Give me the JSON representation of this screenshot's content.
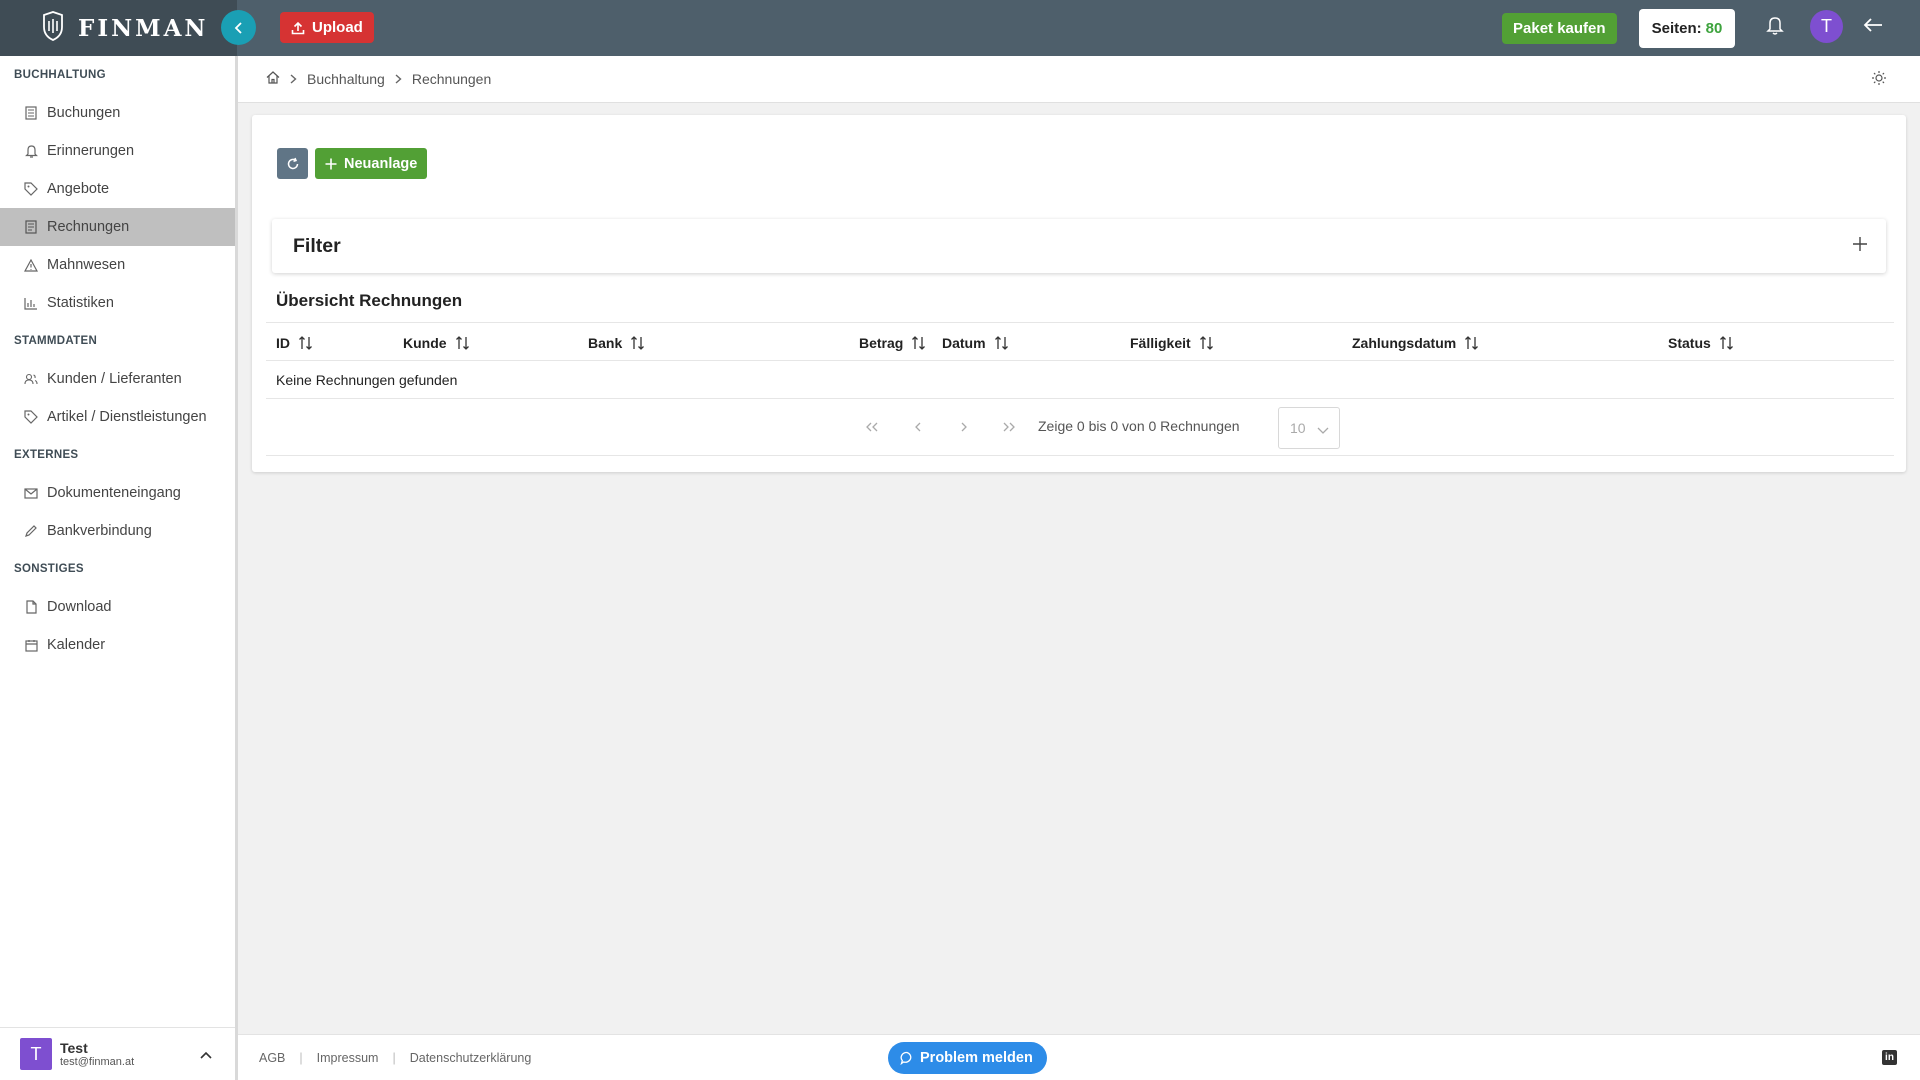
{
  "app": {
    "logo_text": "FINMAN",
    "brand_color": "#4e5f6b"
  },
  "topbar": {
    "upload_label": "Upload",
    "paket_label": "Paket kaufen",
    "seiten_label": "Seiten:",
    "seiten_value": "80",
    "avatar_letter": "T"
  },
  "sidebar": {
    "sections": [
      {
        "title": "BUCHHALTUNG",
        "items": [
          {
            "label": "Buchungen",
            "icon": "ledger-icon"
          },
          {
            "label": "Erinnerungen",
            "icon": "bell-icon"
          },
          {
            "label": "Angebote",
            "icon": "tag-icon"
          },
          {
            "label": "Rechnungen",
            "icon": "invoice-icon",
            "active": true
          },
          {
            "label": "Mahnwesen",
            "icon": "warning-icon"
          },
          {
            "label": "Statistiken",
            "icon": "chart-icon"
          }
        ]
      },
      {
        "title": "STAMMDATEN",
        "items": [
          {
            "label": "Kunden / Lieferanten",
            "icon": "users-icon"
          },
          {
            "label": "Artikel / Dienstleistungen",
            "icon": "tag-icon"
          }
        ]
      },
      {
        "title": "EXTERNES",
        "items": [
          {
            "label": "Dokumenteneingang",
            "icon": "mail-icon"
          },
          {
            "label": "Bankverbindung",
            "icon": "pencil-icon"
          }
        ]
      },
      {
        "title": "SONSTIGES",
        "items": [
          {
            "label": "Download",
            "icon": "file-icon"
          },
          {
            "label": "Kalender",
            "icon": "calendar-icon"
          }
        ]
      }
    ],
    "user": {
      "avatar_letter": "T",
      "name": "Test",
      "email": "test@finman.at"
    }
  },
  "breadcrumb": {
    "items": [
      "Buchhaltung",
      "Rechnungen"
    ]
  },
  "main": {
    "new_label": "Neuanlage",
    "filter_title": "Filter",
    "overview_title": "Übersicht Rechnungen",
    "columns": [
      "ID",
      "Kunde",
      "Bank",
      "Betrag",
      "Datum",
      "Fälligkeit",
      "Zahlungsdatum",
      "Status"
    ],
    "empty_text": "Keine Rechnungen gefunden",
    "pager_text": "Zeige 0 bis 0 von 0 Rechnungen",
    "page_size": "10"
  },
  "footer": {
    "links": [
      "AGB",
      "Impressum",
      "Datenschutzerklärung"
    ],
    "problem_label": "Problem melden"
  }
}
